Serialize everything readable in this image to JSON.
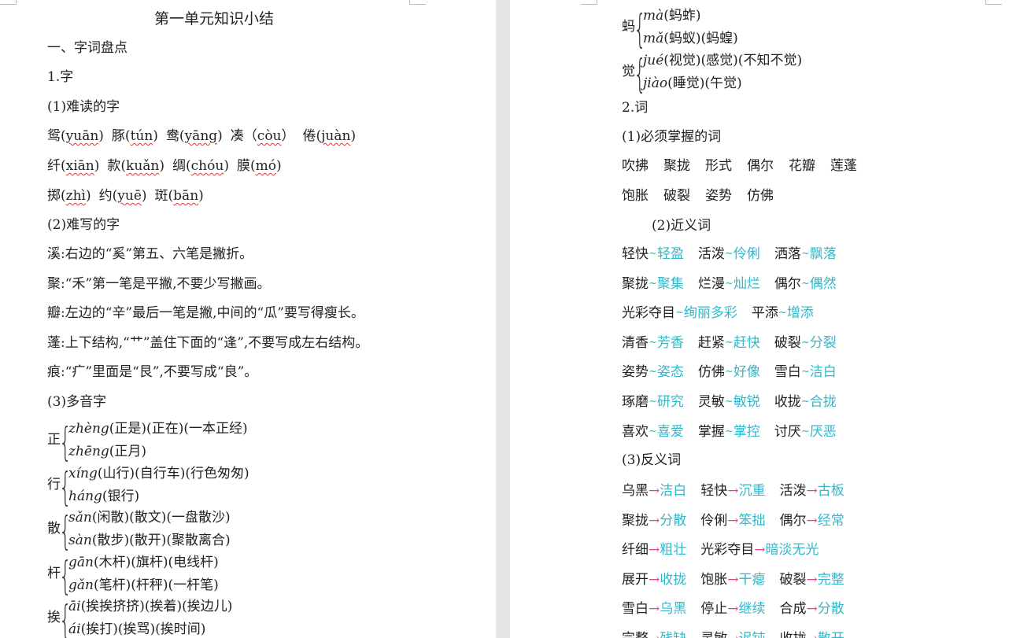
{
  "left": {
    "title": "第一单元知识小结",
    "section1": "一、字词盘点",
    "sub1": "1.字",
    "part1": "(1)难读的字",
    "hard_read": [
      [
        [
          "鸳(",
          "yuān",
          ")"
        ],
        [
          "豚(",
          "tún",
          ")"
        ],
        [
          "鸯(",
          "yāng",
          ")"
        ],
        [
          "凑（",
          "còu",
          "）"
        ],
        [
          "倦(",
          "juàn",
          ")"
        ]
      ],
      [
        [
          "纤(",
          "xiān",
          ")"
        ],
        [
          "款(",
          "kuǎn",
          ")"
        ],
        [
          "绸(",
          "chóu",
          ")"
        ],
        [
          "膜(",
          "mó",
          ")"
        ]
      ],
      [
        [
          "掷(",
          "zhì",
          ")"
        ],
        [
          "约(",
          "yuē",
          ")"
        ],
        [
          "斑(",
          "bān",
          ")"
        ]
      ]
    ],
    "part2": "(2)难写的字",
    "hard_write": [
      "溪:右边的“奚”第五、六笔是撇折。",
      "聚:“禾”第一笔是平撇,不要少写撇画。",
      "瓣:左边的“辛”最后一笔是撇,中间的“瓜”要写得瘦长。",
      "蓬:上下结构,“艹”盖住下面的“逢”,不要写成左右结构。",
      "痕:“疒”里面是“艮”,不要写成“良”。"
    ],
    "part3": "(3)多音字",
    "polyphones": [
      {
        "char": "正",
        "r1_py": "zhèng",
        "r1_words": "(正是)(正在)(一本正经)",
        "r2_py": "zhēng",
        "r2_words": "(正月)"
      },
      {
        "char": "行",
        "r1_py": "xíng",
        "r1_words": "(山行)(自行车)(行色匆匆)",
        "r2_py": "háng",
        "r2_words": "(银行)"
      },
      {
        "char": "散",
        "r1_py": "sǎn",
        "r1_words": "(闲散)(散文)(一盘散沙)",
        "r2_py": "sàn",
        "r2_words": "(散步)(散开)(聚散离合)"
      },
      {
        "char": "杆",
        "r1_py": "gān",
        "r1_words": "(木杆)(旗杆)(电线杆)",
        "r2_py": "gǎn",
        "r2_words": "(笔杆)(杆秤)(一杆笔)"
      },
      {
        "char": "挨",
        "r1_py": "āi",
        "r1_words": "(挨挨挤挤)(挨着)(挨边儿)",
        "r2_py": "ái",
        "r2_words": "(挨打)(挨骂)(挨时间)"
      }
    ]
  },
  "right": {
    "polyphones": [
      {
        "char": "蚂",
        "r1_py": "mà",
        "r1_words": "(蚂蚱)",
        "r2_py": "mǎ",
        "r2_words": "(蚂蚁)(蚂蝗)"
      },
      {
        "char": "觉",
        "r1_py": "jué",
        "r1_words": "(视觉)(感觉)(不知不觉)",
        "r2_py": "jiào",
        "r2_words": "(睡觉)(午觉)"
      }
    ],
    "sub2": "2.词",
    "part1": "(1)必须掌握的词",
    "must_words": [
      [
        "吹拂",
        "聚拢",
        "形式",
        "偶尔",
        "花瓣",
        "莲蓬"
      ],
      [
        "饱胀",
        "破裂",
        "姿势",
        "仿佛"
      ]
    ],
    "part2": "(2)近义词",
    "tilde_sym": "~",
    "synonyms": [
      [
        [
          "轻快",
          "轻盈"
        ],
        [
          "活泼",
          "伶俐"
        ],
        [
          "洒落",
          "飘落"
        ]
      ],
      [
        [
          "聚拢",
          "聚集"
        ],
        [
          "烂漫",
          "灿烂"
        ],
        [
          "偶尔",
          "偶然"
        ]
      ],
      [
        [
          "光彩夺目",
          "绚丽多彩"
        ],
        [
          "平添",
          "增添"
        ]
      ],
      [
        [
          "清香",
          "芳香"
        ],
        [
          "赶紧",
          "赶快"
        ],
        [
          "破裂",
          "分裂"
        ]
      ],
      [
        [
          "姿势",
          "姿态"
        ],
        [
          "仿佛",
          "好像"
        ],
        [
          "雪白",
          "洁白"
        ]
      ],
      [
        [
          "琢磨",
          "研究"
        ],
        [
          "灵敏",
          "敏锐"
        ],
        [
          "收拢",
          "合拢"
        ]
      ],
      [
        [
          "喜欢",
          "喜爱"
        ],
        [
          "掌握",
          "掌控"
        ],
        [
          "讨厌",
          "厌恶"
        ]
      ]
    ],
    "part3": "(3)反义词",
    "arrow_sym": "→",
    "antonyms": [
      [
        [
          "乌黑",
          "洁白"
        ],
        [
          "轻快",
          "沉重"
        ],
        [
          "活泼",
          "古板"
        ]
      ],
      [
        [
          "聚拢",
          "分散"
        ],
        [
          "伶俐",
          "笨拙"
        ],
        [
          "偶尔",
          "经常"
        ]
      ],
      [
        [
          "纤细",
          "粗壮"
        ],
        [
          "光彩夺目",
          "暗淡无光"
        ]
      ],
      [
        [
          "展开",
          "收拢"
        ],
        [
          "饱胀",
          "干瘪"
        ],
        [
          "破裂",
          "完整"
        ]
      ],
      [
        [
          "雪白",
          "乌黑"
        ],
        [
          "停止",
          "继续"
        ],
        [
          "合成",
          "分散"
        ]
      ],
      [
        [
          "完整",
          "残缺"
        ],
        [
          "灵敏",
          "迟钝"
        ],
        [
          "收拢",
          "散开"
        ]
      ]
    ]
  }
}
